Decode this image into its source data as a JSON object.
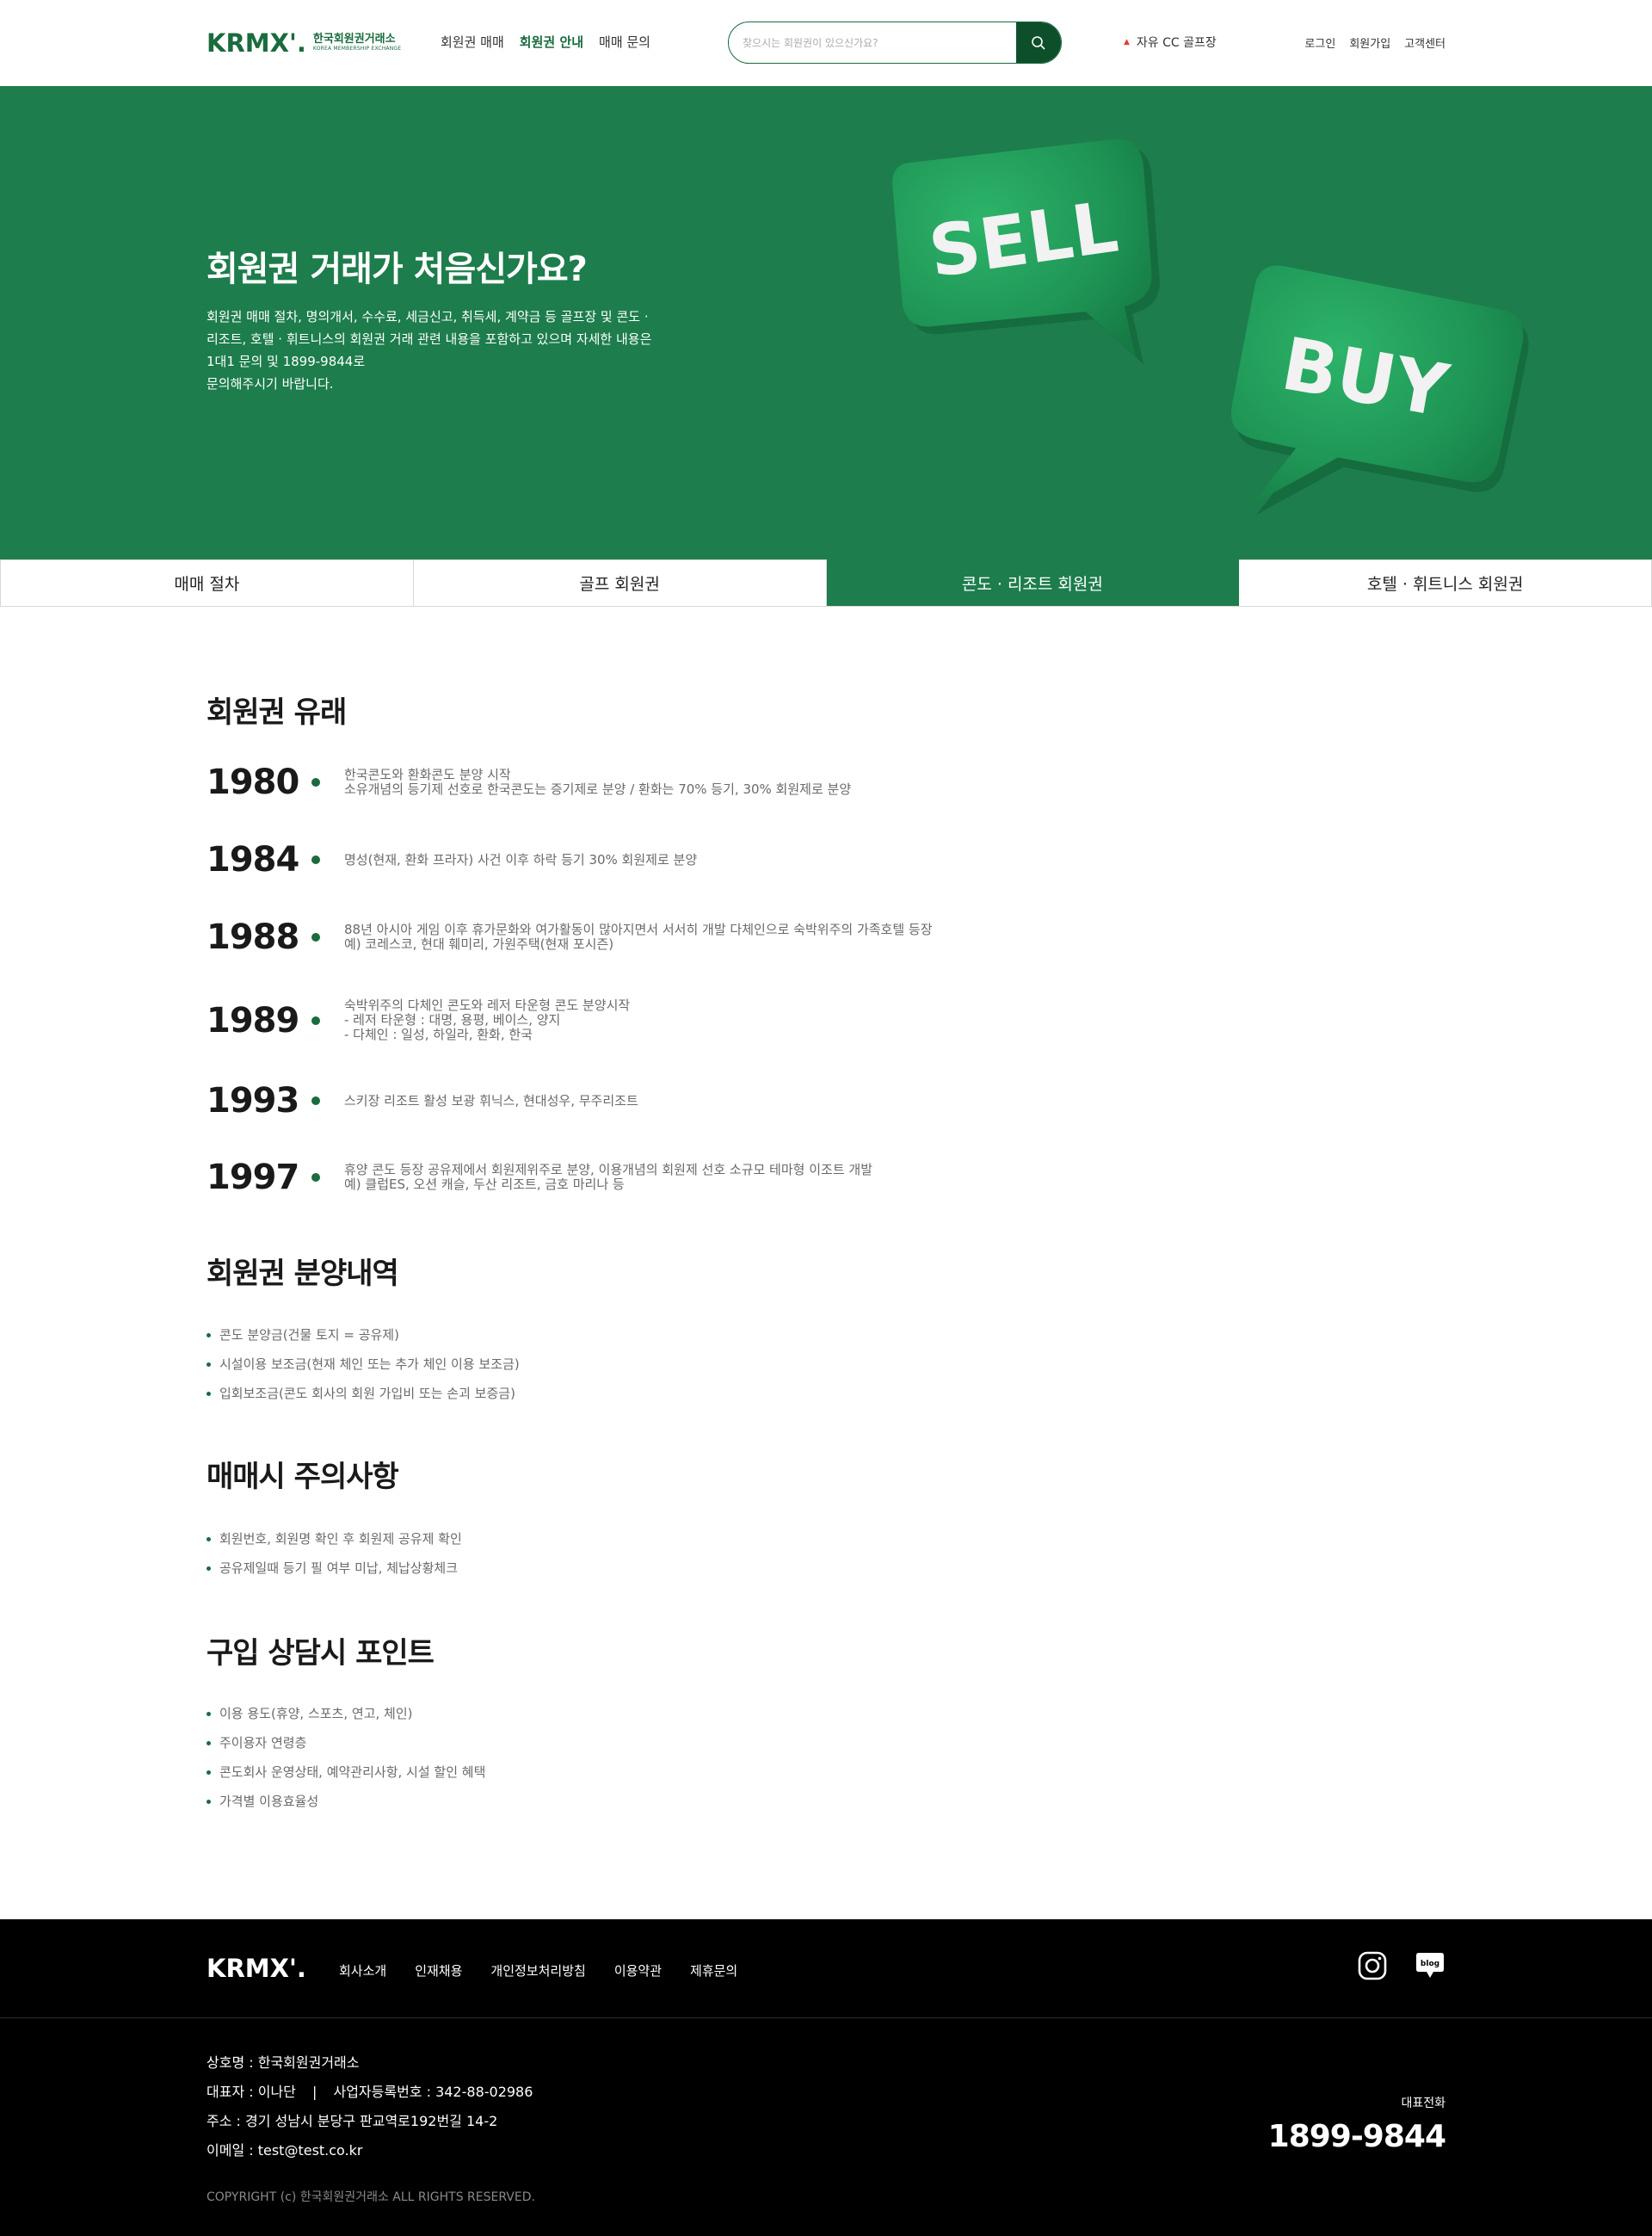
{
  "header": {
    "logo_mark": "KRMX'.",
    "logo_ko": "한국회원권거래소",
    "logo_en": "KOREA MEMBERSHIP EXCHANGE",
    "nav": [
      {
        "label": "회원권 매매"
      },
      {
        "label": "회원권 안내"
      },
      {
        "label": "매매 문의"
      }
    ],
    "active_nav": "회원권 안내",
    "search": {
      "placeholder": "찾으시는 회원권이 있으신가요?"
    },
    "ticker": "자유 CC 골프장",
    "util": [
      {
        "label": "로그인"
      },
      {
        "label": "회원가입"
      },
      {
        "label": "고객센터"
      }
    ]
  },
  "hero": {
    "title": "회원권 거래가 처음신가요?",
    "desc": [
      "회원권 매매 절차, 명의개서, 수수료, 세금신고, 취득세, 계약금 등 골프장 및 콘도 ·",
      "리조트, 호텔 · 휘트니스의 회원권 거래 관련 내용을 포함하고 있으며 자세한 내용은",
      "1대1 문의 및 1899-9844로",
      "문의해주시기 바랍니다."
    ],
    "bubble_sell": "SELL",
    "bubble_buy": "BUY",
    "bg_color": "#1d7d4c"
  },
  "tabs": [
    {
      "label": "매매 절차"
    },
    {
      "label": "골프 회원권"
    },
    {
      "label": "콘도 · 리조트 회원권"
    },
    {
      "label": "호텔 · 휘트니스 회원권"
    }
  ],
  "active_tab": "콘도 · 리조트 회원권",
  "sections": {
    "origin": {
      "title": "회원권 유래",
      "timeline": [
        {
          "year": "1980",
          "lines": [
            "한국콘도와 환화콘도 분양 시작",
            "소유개념의 등기제 선호로 한국콘도는 증기제로 분양 / 환화는 70% 등기, 30% 회원제로 분양"
          ]
        },
        {
          "year": "1984",
          "lines": [
            "명성(현재, 환화 프라자) 사건 이후 하락 등기 30% 회원제로 분양"
          ]
        },
        {
          "year": "1988",
          "lines": [
            "88년 아시아 게임 이후 휴가문화와 여가활동이 많아지면서 서서히 개발 다체인으로 숙박위주의 가족호텔 등장",
            "예) 코레스코, 현대 훼미리, 가원주택(현재 포시즌)"
          ]
        },
        {
          "year": "1989",
          "lines": [
            "숙박위주의 다체인 콘도와 레저 타운형 콘도 분양시작",
            "- 레저 타운형 : 대명, 용평, 베이스, 양지",
            "- 다체인 : 일성, 하일라, 환화, 한국"
          ]
        },
        {
          "year": "1993",
          "lines": [
            "스키장 리조트 활성 보광 휘닉스, 현대성우, 무주리조트"
          ]
        },
        {
          "year": "1997",
          "lines": [
            "휴양 콘도 등장 공유제에서 회원제위주로 분양, 이용개념의 회원제 선호 소규모 테마형 이조트 개발",
            "예) 클럽ES, 오션 캐슬, 두산 리조트, 금호 마리나 등"
          ]
        }
      ]
    },
    "sale": {
      "title": "회원권 분양내역",
      "items": [
        "콘도 분양금(건물 토지 = 공유제)",
        "시설이용 보조금(현재 체인 또는 추가 체인 이용 보조금)",
        "입회보조금(콘도 회사의 회원 가입비 또는 손괴 보증금)"
      ]
    },
    "caution": {
      "title": "매매시 주의사항",
      "items": [
        "회원번호, 회원명 확인 후 회원제 공유제 확인",
        "공유제일때 등기 필 여부 미납, 체납상황체크"
      ]
    },
    "points": {
      "title": "구입 상담시 포인트",
      "items": [
        "이용 용도(휴양, 스포츠, 연고, 체인)",
        "주이용자 연령층",
        "콘도회사 운영상태, 예약관리사항, 시설 할인 혜택",
        "가격별 이용효율성"
      ]
    }
  },
  "footer": {
    "logo": "KRMX'.",
    "nav": [
      {
        "label": "회사소개"
      },
      {
        "label": "인재채용"
      },
      {
        "label": "개인정보처리방침"
      },
      {
        "label": "이용약관"
      },
      {
        "label": "제휴문의"
      }
    ],
    "sns": {
      "instagram": "instagram-icon",
      "blog": "blog",
      "blog_icon": "blog-icon"
    },
    "info": {
      "company": "상호명 : 한국회원권거래소",
      "ceo": "대표자 : 이나단",
      "biz_no": "사업자등록번호 : 342-88-02986",
      "address": "주소 : 경기 성남시 분당구 판교역로192번길 14-2",
      "email": "이메일 : test@test.co.kr"
    },
    "copyright": "COPYRIGHT (c) 한국회원권거래소 ALL RIGHTS RESERVED.",
    "call_label": "대표전화",
    "call_number": "1899-9844"
  },
  "colors": {
    "brand": "#1a6b3e",
    "hero_bg": "#1d7d4c",
    "highlight": "#8fc3a3",
    "footer_bg": "#000000"
  }
}
